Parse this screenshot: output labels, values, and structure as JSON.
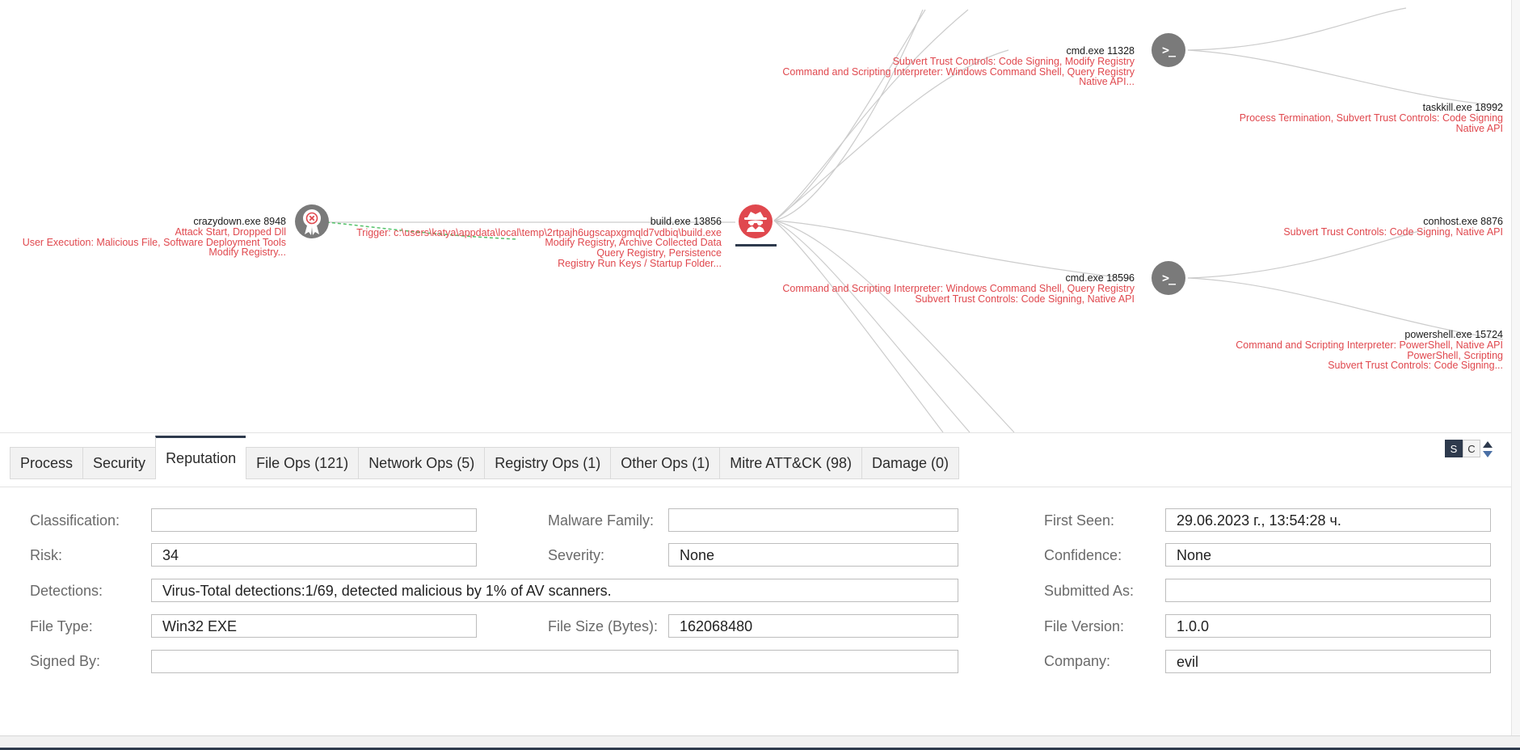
{
  "graph": {
    "nodes": {
      "crazydown": {
        "name": "crazydown.exe 8948",
        "tech": [
          "Attack Start, Dropped Dll",
          "User Execution: Malicious File, Software Deployment Tools",
          "Modify Registry..."
        ]
      },
      "build": {
        "name": "build.exe 13856",
        "trigger": "Trigger: c:\\users\\katya\\appdata\\local\\temp\\2rtpajh6ugscapxgmqld7vdbiq\\build.exe",
        "tech": [
          "Modify Registry, Archive Collected Data",
          "Query Registry, Persistence",
          "Registry Run Keys / Startup Folder..."
        ]
      },
      "cmd1": {
        "name": "cmd.exe 11328",
        "tech": [
          "Subvert Trust Controls: Code Signing, Modify Registry",
          "Command and Scripting Interpreter: Windows Command Shell, Query Registry",
          "Native API..."
        ]
      },
      "taskkill": {
        "name": "taskkill.exe 18992",
        "tech": [
          "Process Termination, Subvert Trust Controls: Code Signing",
          "Native API"
        ]
      },
      "conhost": {
        "name": "conhost.exe 8876",
        "tech": [
          "Subvert Trust Controls: Code Signing, Native API"
        ]
      },
      "cmd2": {
        "name": "cmd.exe 18596",
        "tech": [
          "Command and Scripting Interpreter: Windows Command Shell, Query Registry",
          "Subvert Trust Controls: Code Signing, Native API"
        ]
      },
      "powershell": {
        "name": "powershell.exe 15724",
        "tech": [
          "Command and Scripting Interpreter: PowerShell, Native API",
          "PowerShell, Scripting",
          "Subvert Trust Controls: Code Signing..."
        ]
      }
    },
    "icons": {
      "terminal_glyph": ">_"
    }
  },
  "tabs": [
    {
      "label": "Process"
    },
    {
      "label": "Security"
    },
    {
      "label": "Reputation",
      "active": true
    },
    {
      "label": "File Ops (121)"
    },
    {
      "label": "Network Ops (5)"
    },
    {
      "label": "Registry Ops (1)"
    },
    {
      "label": "Other Ops (1)"
    },
    {
      "label": "Mitre ATT&CK (98)"
    },
    {
      "label": "Damage (0)"
    }
  ],
  "toggles": {
    "s": "S",
    "c": "C"
  },
  "reputation": {
    "classification": {
      "label": "Classification:",
      "value": ""
    },
    "malware_family": {
      "label": "Malware Family:",
      "value": ""
    },
    "first_seen": {
      "label": "First Seen:",
      "value": "29.06.2023 г., 13:54:28 ч."
    },
    "risk": {
      "label": "Risk:",
      "value": "34"
    },
    "severity": {
      "label": "Severity:",
      "value": "None"
    },
    "confidence": {
      "label": "Confidence:",
      "value": "None"
    },
    "detections": {
      "label": "Detections:",
      "value": "Virus-Total detections:1/69, detected malicious by 1% of AV scanners."
    },
    "submitted_as": {
      "label": "Submitted As:",
      "value": ""
    },
    "file_type": {
      "label": "File Type:",
      "value": "Win32 EXE"
    },
    "file_size": {
      "label": "File Size (Bytes):",
      "value": "162068480"
    },
    "file_version": {
      "label": "File Version:",
      "value": "1.0.0"
    },
    "signed_by": {
      "label": "Signed By:",
      "value": ""
    },
    "company": {
      "label": "Company:",
      "value": "evil"
    }
  },
  "colors": {
    "accent_red": "#e0484e",
    "node_gray": "#7a7a7a",
    "tab_active_border": "#2e3a4d"
  }
}
